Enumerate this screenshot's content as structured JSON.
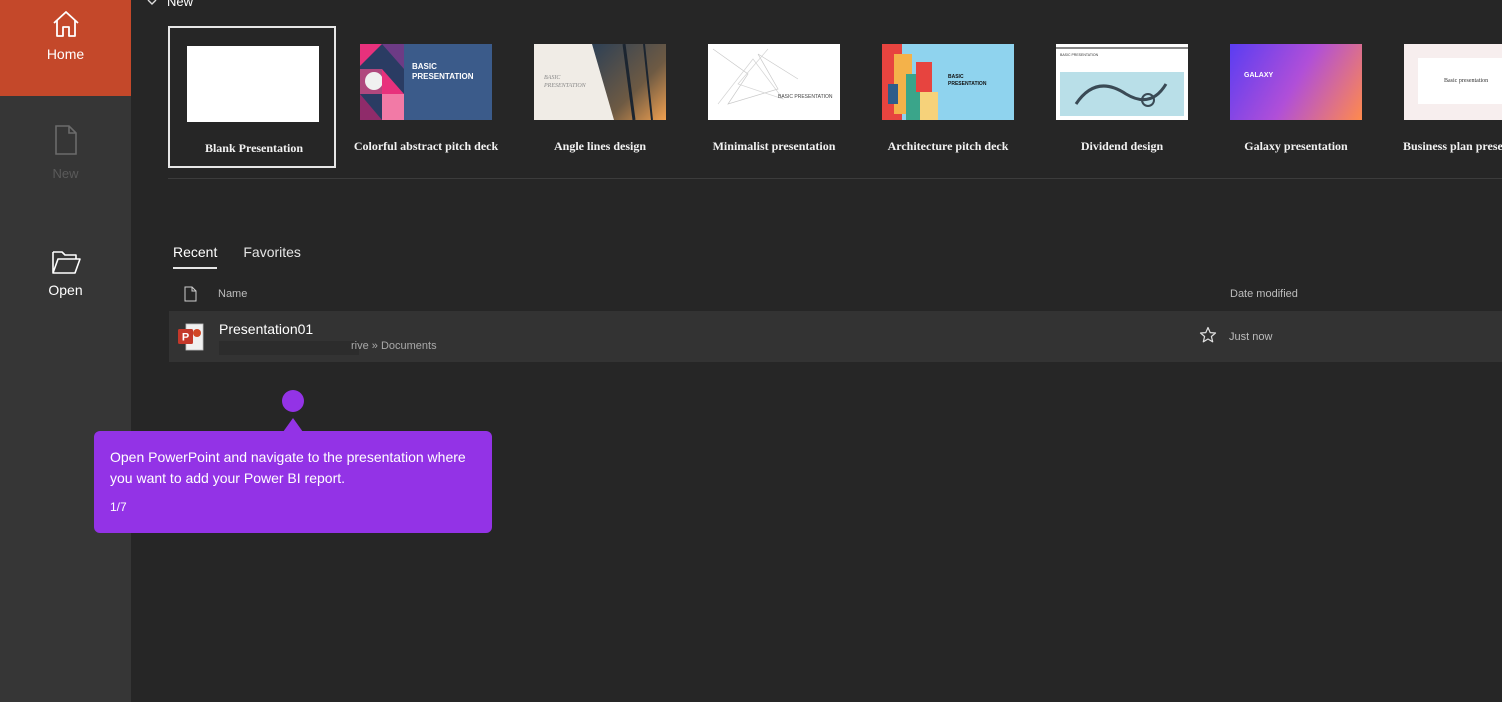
{
  "sidebar": {
    "items": [
      {
        "label": "Home",
        "icon": "home-icon"
      },
      {
        "label": "New",
        "icon": "new-file-icon"
      },
      {
        "label": "Open",
        "icon": "open-folder-icon"
      }
    ]
  },
  "new_section": {
    "header": "New",
    "templates": [
      {
        "label": "Blank Presentation"
      },
      {
        "label": "Colorful abstract pitch deck",
        "thumb_text": "BASIC PRESENTATION"
      },
      {
        "label": "Angle lines design",
        "thumb_text": "BASIC PRESENTATION"
      },
      {
        "label": "Minimalist presentation",
        "thumb_text": "BASIC PRESENTATION"
      },
      {
        "label": "Architecture pitch deck",
        "thumb_text": "BASIC PRESENTATION"
      },
      {
        "label": "Dividend design",
        "thumb_text": "BASIC PRESENTATION"
      },
      {
        "label": "Galaxy presentation",
        "thumb_text": "GALAXY"
      },
      {
        "label": "Business plan prese",
        "thumb_text": "Basic presentation"
      }
    ]
  },
  "tabs": [
    {
      "label": "Recent"
    },
    {
      "label": "Favorites"
    }
  ],
  "table": {
    "col_name": "Name",
    "col_date": "Date modified",
    "rows": [
      {
        "name": "Presentation01",
        "path": "rive » Documents",
        "date": "Just now"
      }
    ]
  },
  "tooltip": {
    "text": "Open PowerPoint and navigate to the presentation where you want to add your Power BI report.",
    "step": "1/7"
  },
  "colors": {
    "accent": "#c4482a",
    "tooltip": "#9333e6",
    "background": "#262626",
    "sidebar": "#363636"
  }
}
